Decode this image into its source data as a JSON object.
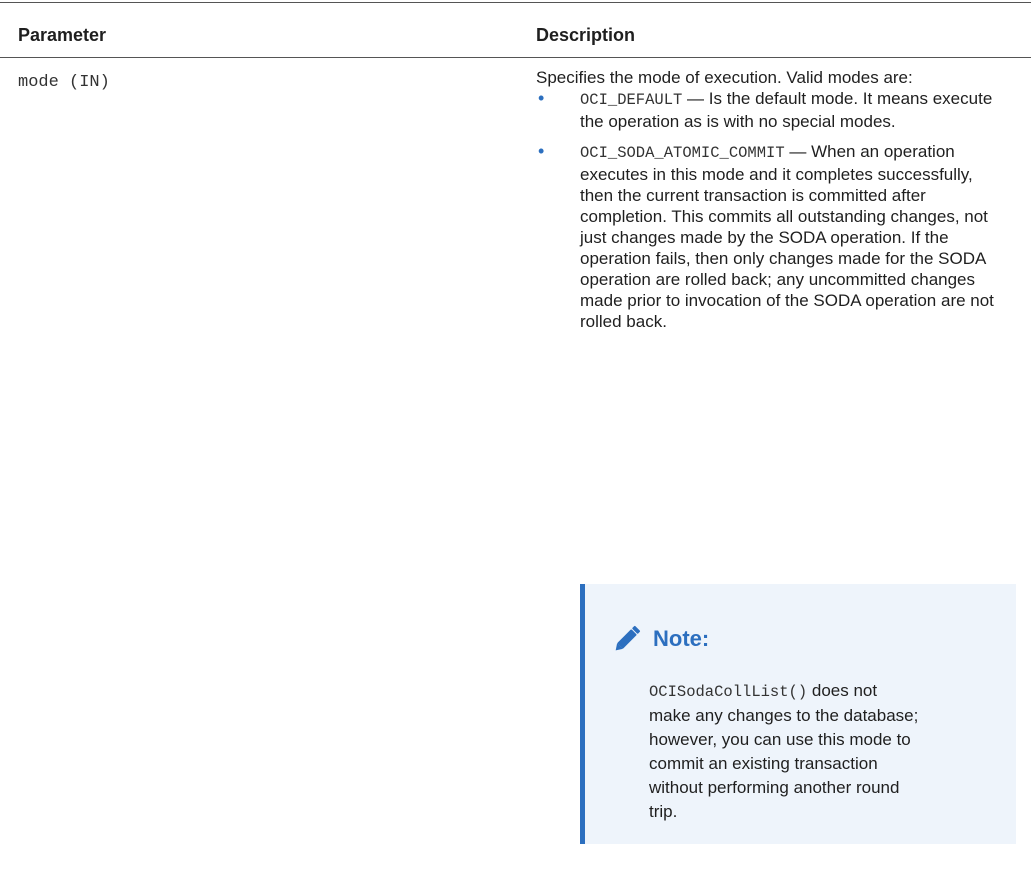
{
  "table": {
    "headers": {
      "parameter": "Parameter",
      "description": "Description"
    },
    "row": {
      "parameter": "mode (IN)",
      "description_intro": "Specifies the mode of execution. Valid modes are:",
      "bullets": [
        {
          "code": "OCI_DEFAULT",
          "text": " — Is the default mode. It means execute the operation as is with no special modes."
        },
        {
          "code": "OCI_SODA_ATOMIC_COMMIT",
          "text": " — When an operation executes in this mode and it completes successfully, then the current transaction is committed after completion. This commits all outstanding changes, not just changes made by the SODA operation. If the operation fails, then only changes made for the SODA operation are rolled back; any uncommitted changes made prior to invocation of the SODA operation are not rolled back."
        }
      ],
      "bullet_glyph": "•"
    }
  },
  "note": {
    "title": "Note:",
    "icon": "pencil-icon",
    "code": "OCISodaCollList()",
    "text": " does not make any changes to the database; however, you can use this mode to commit an existing transaction without performing another round trip."
  },
  "colors": {
    "accent": "#2c6fbf",
    "note_background": "#eef4fb",
    "rule": "#555555"
  }
}
